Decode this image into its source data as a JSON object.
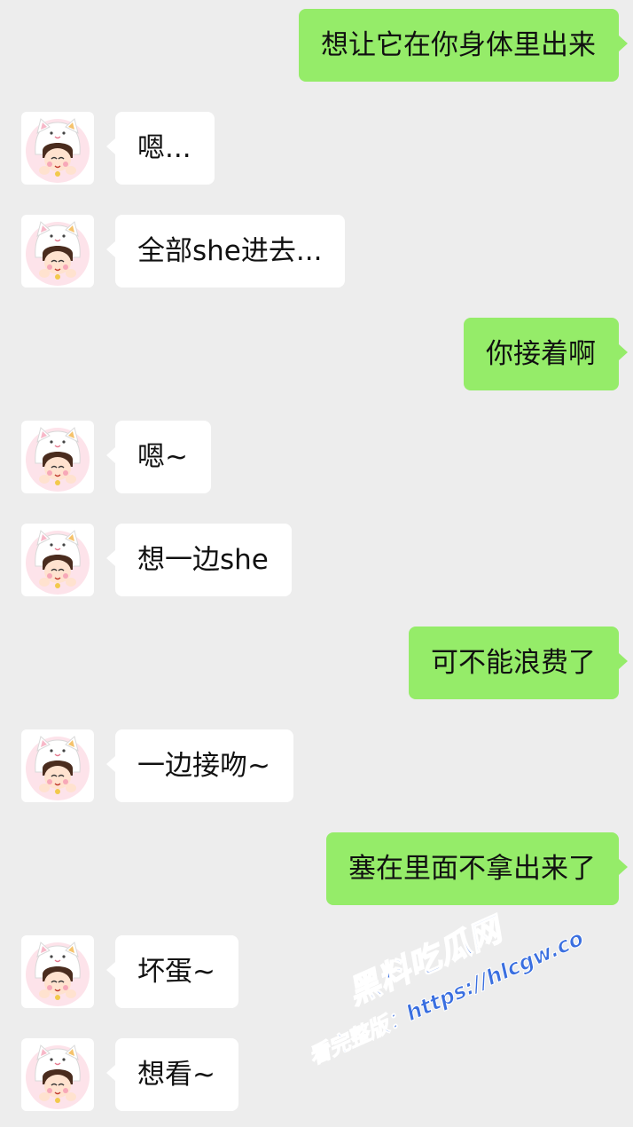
{
  "messages": [
    {
      "side": "out",
      "text": "想让它在你身体里出来"
    },
    {
      "side": "in",
      "text": "嗯..."
    },
    {
      "side": "in",
      "text": "全部she进去..."
    },
    {
      "side": "out",
      "text": "你接着啊"
    },
    {
      "side": "in",
      "text": "嗯~"
    },
    {
      "side": "in",
      "text": "想一边she"
    },
    {
      "side": "out",
      "text": "可不能浪费了"
    },
    {
      "side": "in",
      "text": "一边接吻~"
    },
    {
      "side": "out",
      "text": "塞在里面不拿出来了"
    },
    {
      "side": "in",
      "text": "坏蛋~"
    },
    {
      "side": "in",
      "text": "想看~"
    }
  ],
  "watermark": {
    "title": "黑料吃瓜网",
    "line": "看完整版：https://hlcgw.co"
  },
  "colors": {
    "background": "#ededed",
    "outgoing_bubble": "#95ec69",
    "incoming_bubble": "#ffffff",
    "watermark": "#3a6fe0"
  }
}
